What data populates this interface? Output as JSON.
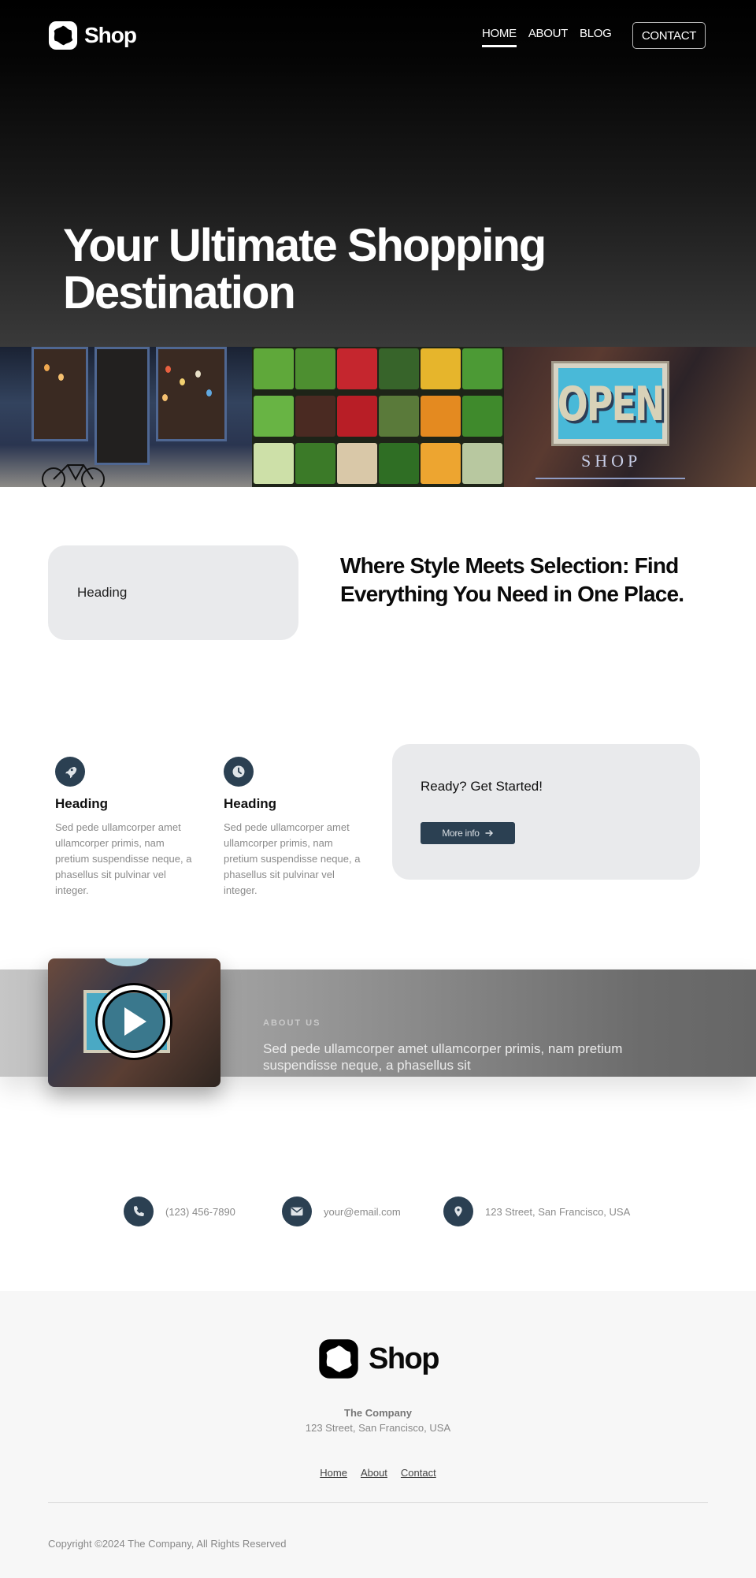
{
  "header": {
    "brand": "Shop",
    "nav": [
      {
        "label": "HOME",
        "active": true
      },
      {
        "label": "ABOUT",
        "active": false
      },
      {
        "label": "BLOG",
        "active": false
      }
    ],
    "contact_label": "CONTACT"
  },
  "hero": {
    "title_line1": "Your Ultimate Shopping",
    "title_line2": "Destination"
  },
  "gallery": {
    "images": [
      {
        "name": "storefront-image",
        "alt": "Storefront with bicycle"
      },
      {
        "name": "vegetables-image",
        "alt": "Produce shelves"
      },
      {
        "name": "open-sign-image",
        "alt": "OPEN SHOP sign",
        "sign_text": "OPEN",
        "sign_subtext": "SHOP"
      }
    ]
  },
  "feature": {
    "card_heading": "Heading",
    "title": "Where Style Meets Selection: Find Everything You Need in One Place."
  },
  "services": {
    "items": [
      {
        "icon": "rocket-icon",
        "title": "Heading",
        "text": "Sed pede ullamcorper amet ullamcorper primis, nam pretium suspendisse neque, a phasellus sit pulvinar vel integer."
      },
      {
        "icon": "clock-icon",
        "title": "Heading",
        "text": "Sed pede ullamcorper amet ullamcorper primis, nam pretium suspendisse neque, a phasellus sit pulvinar vel integer."
      }
    ],
    "cta": {
      "title": "Ready? Get Started!",
      "button_label": "More info",
      "button_icon": "arrow-right-icon"
    }
  },
  "about": {
    "label": "ABOUT US",
    "text": "Sed pede ullamcorper amet ullamcorper primis, nam pretium suspendisse neque, a phasellus sit",
    "video_icon": "play-icon"
  },
  "contacts": [
    {
      "icon": "phone-icon",
      "text": "(123) 456-7890"
    },
    {
      "icon": "email-icon",
      "text": "your@email.com"
    },
    {
      "icon": "location-pin-icon",
      "text": "123 Street, San Francisco, USA"
    }
  ],
  "footer": {
    "brand": "Shop",
    "company": "The Company",
    "address": "123 Street, San Francisco, USA",
    "links": [
      "Home",
      "About",
      "Contact"
    ],
    "copyright": "Copyright ©2024 The Company, All Rights Reserved"
  },
  "colors": {
    "accent": "#2b4052",
    "card_bg": "#e9eaec",
    "footer_bg": "#f7f7f7"
  }
}
